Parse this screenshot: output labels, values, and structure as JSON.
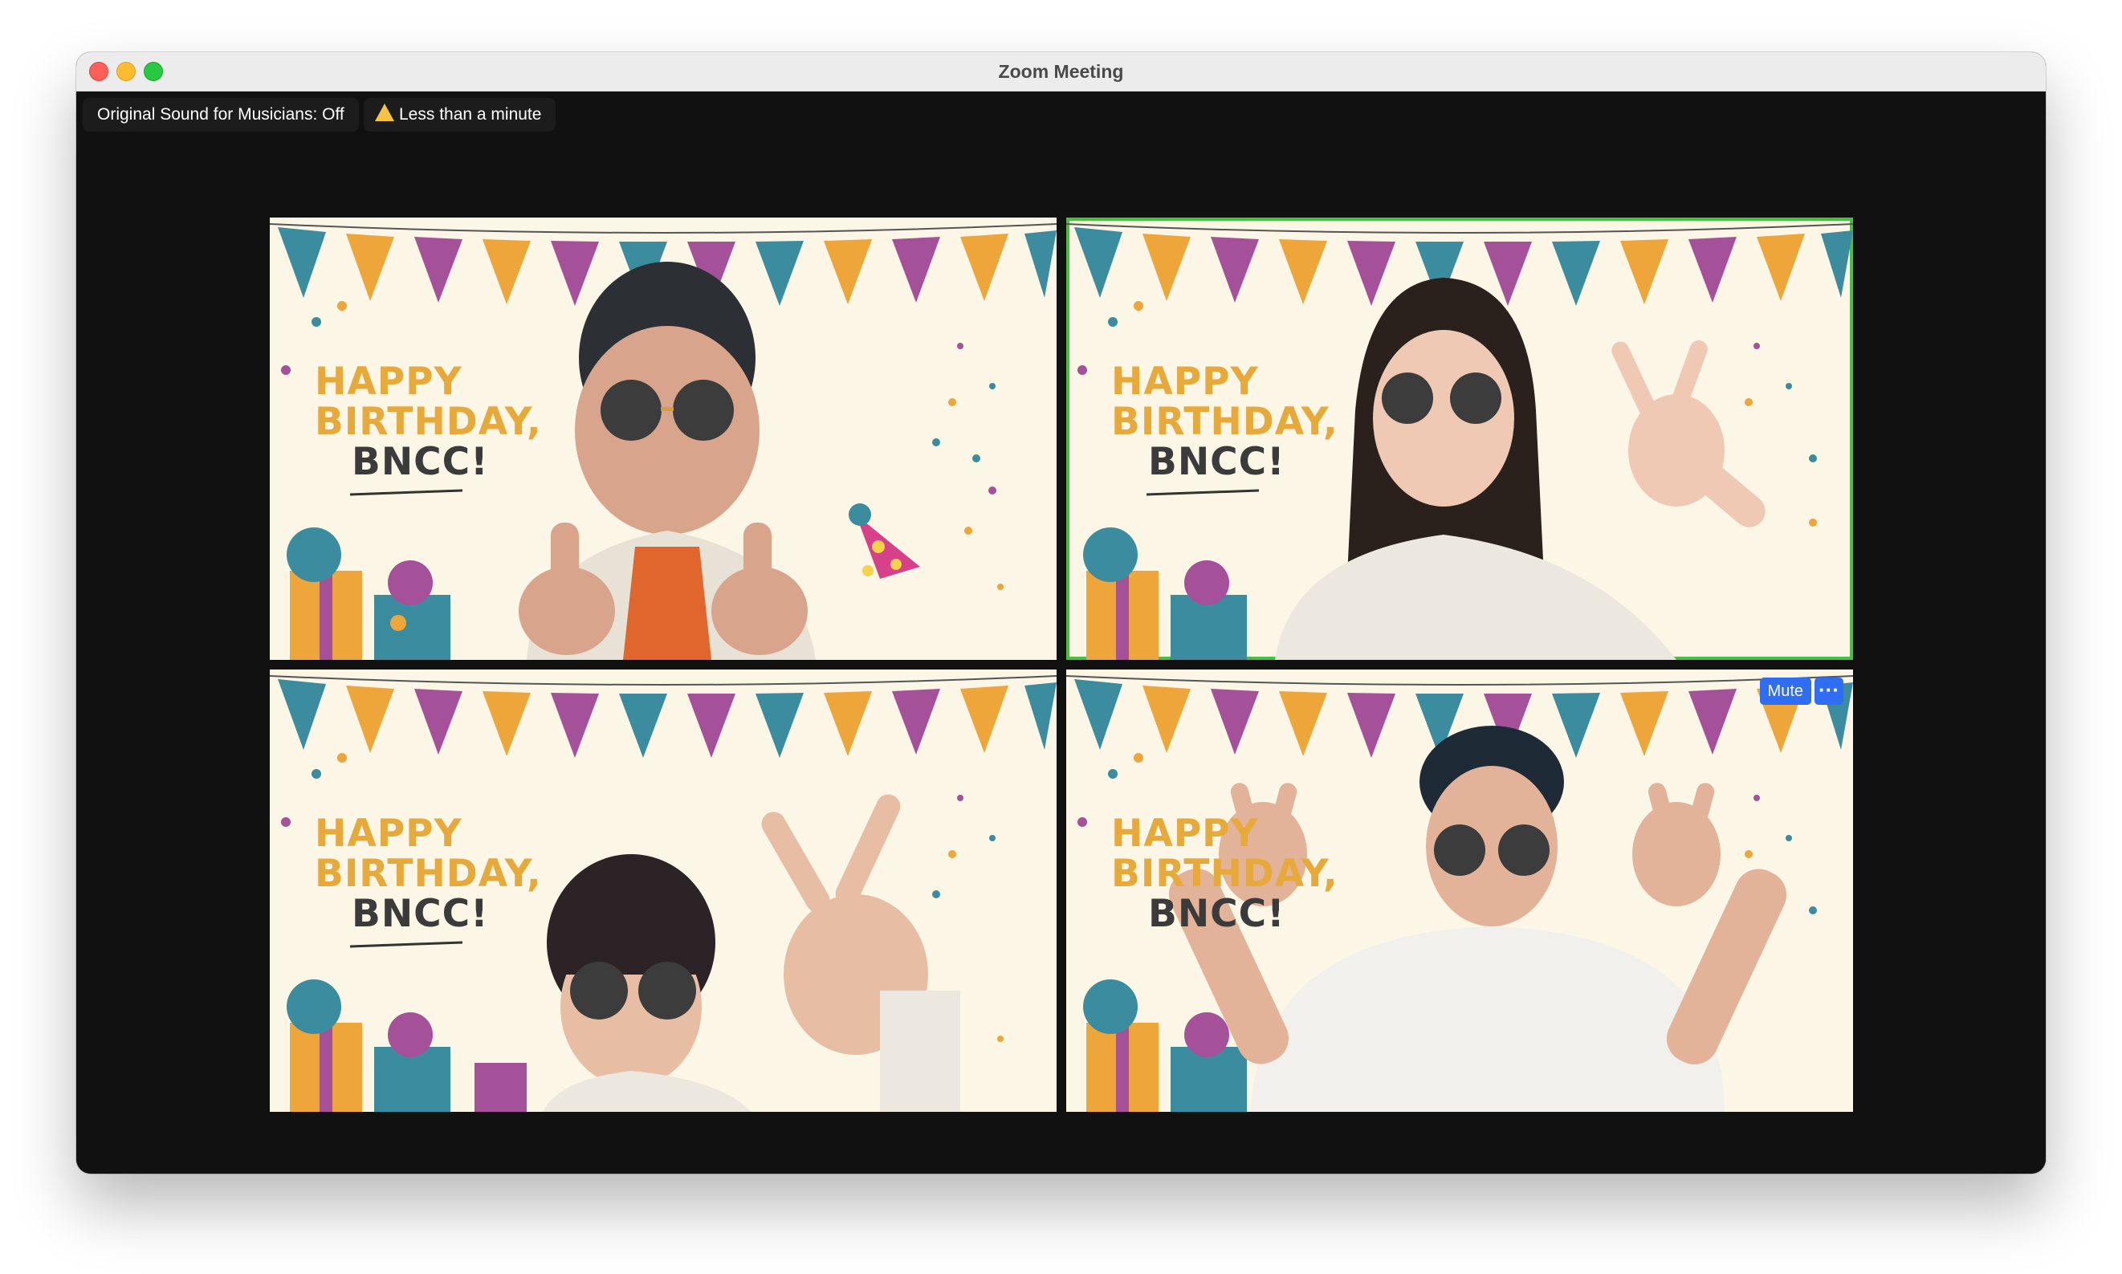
{
  "window": {
    "title": "Zoom Meeting"
  },
  "overlays": {
    "sound_label": "Original Sound for Musicians: Off",
    "timer_label": "Less than a minute"
  },
  "tiles": [
    {
      "banner_lines": [
        "HAPPY",
        "BIRTHDAY,",
        "BNCC!"
      ],
      "active": false
    },
    {
      "banner_lines": [
        "HAPPY",
        "BIRTHDAY,",
        "BNCC!"
      ],
      "active": true
    },
    {
      "banner_lines": [
        "HAPPY",
        "BIRTHDAY,",
        "BNCC!"
      ],
      "active": false
    },
    {
      "banner_lines": [
        "HAPPY",
        "BIRTHDAY,",
        "BNCC!"
      ],
      "active": false,
      "mute_label": "Mute",
      "more_label": "···"
    }
  ],
  "colors": {
    "background": "#fbf6e6",
    "active_border": "#48c03e",
    "button_blue": "#2f6df2",
    "flag_teal": "#3b8c9e",
    "flag_orange": "#eea63a",
    "flag_purple": "#a4519a"
  }
}
